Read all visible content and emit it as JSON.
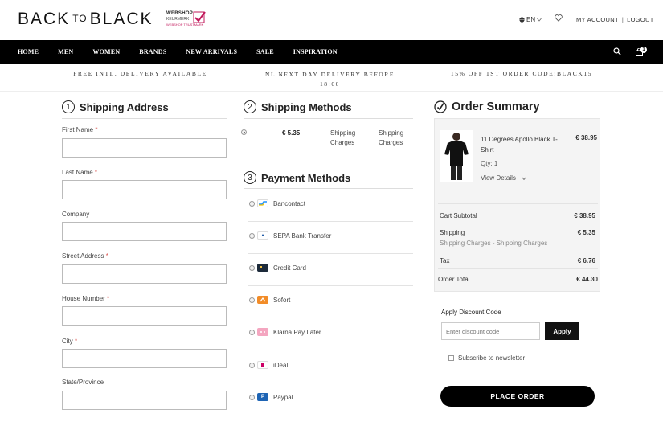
{
  "header": {
    "logo_left": "BACK",
    "logo_to": "TO",
    "logo_right": "BLACK",
    "trust_line1": "WEBSHOP",
    "trust_line2": "KEURMERK",
    "trust_line3": "WEBSHOP TRUSTMARK",
    "language": "EN",
    "my_account": "MY ACCOUNT",
    "separator": "|",
    "logout": "LOGOUT"
  },
  "nav": {
    "items": [
      "HOME",
      "MEN",
      "WOMEN",
      "BRANDS",
      "NEW ARRIVALS",
      "SALE",
      "INSPIRATION"
    ],
    "cart_count": "1"
  },
  "promo": {
    "free_delivery": "FREE INTL. DELIVERY AVAILABLE",
    "next_day": "NL NEXT DAY DELIVERY BEFORE 18:00",
    "discount": "15% OFF 1ST ORDER CODE:BLACK15"
  },
  "shipping_address": {
    "number": "1",
    "title": "Shipping Address",
    "fields": [
      {
        "label": "First Name",
        "required": true
      },
      {
        "label": "Last Name",
        "required": true
      },
      {
        "label": "Company",
        "required": false
      },
      {
        "label": "Street Address",
        "required": true
      },
      {
        "label": "House Number",
        "required": true
      },
      {
        "label": "City",
        "required": true
      },
      {
        "label": "State/Province",
        "required": false
      }
    ]
  },
  "shipping_methods": {
    "number": "2",
    "title": "Shipping Methods",
    "price": "€ 5.35",
    "method_line1": "Shipping",
    "method_line2": "Charges",
    "carrier_line1": "Shipping",
    "carrier_line2": "Charges"
  },
  "payment_methods": {
    "number": "3",
    "title": "Payment Methods",
    "options": [
      "Bancontact",
      "SEPA Bank Transfer",
      "Credit Card",
      "Sofort",
      "Klarna Pay Later",
      "iDeal",
      "Paypal"
    ]
  },
  "order_summary": {
    "title": "Order Summary",
    "product_name_line1": "11 Degrees Apollo Black T-",
    "product_name_line2": "Shirt",
    "product_price": "€ 38.95",
    "qty_label": "Qty:",
    "qty": "1",
    "view_details": "View Details",
    "cart_subtotal_label": "Cart Subtotal",
    "cart_subtotal": "€ 38.95",
    "shipping_label": "Shipping",
    "shipping_sub": "Shipping Charges - Shipping Charges",
    "shipping_value": "€ 5.35",
    "tax_label": "Tax",
    "tax_value": "€ 6.76",
    "order_total_label": "Order Total",
    "order_total": "€ 44.30"
  },
  "discount": {
    "label": "Apply Discount Code",
    "placeholder": "Enter discount code",
    "apply": "Apply"
  },
  "newsletter": "Subscribe to newsletter",
  "place_order": "PLACE ORDER"
}
